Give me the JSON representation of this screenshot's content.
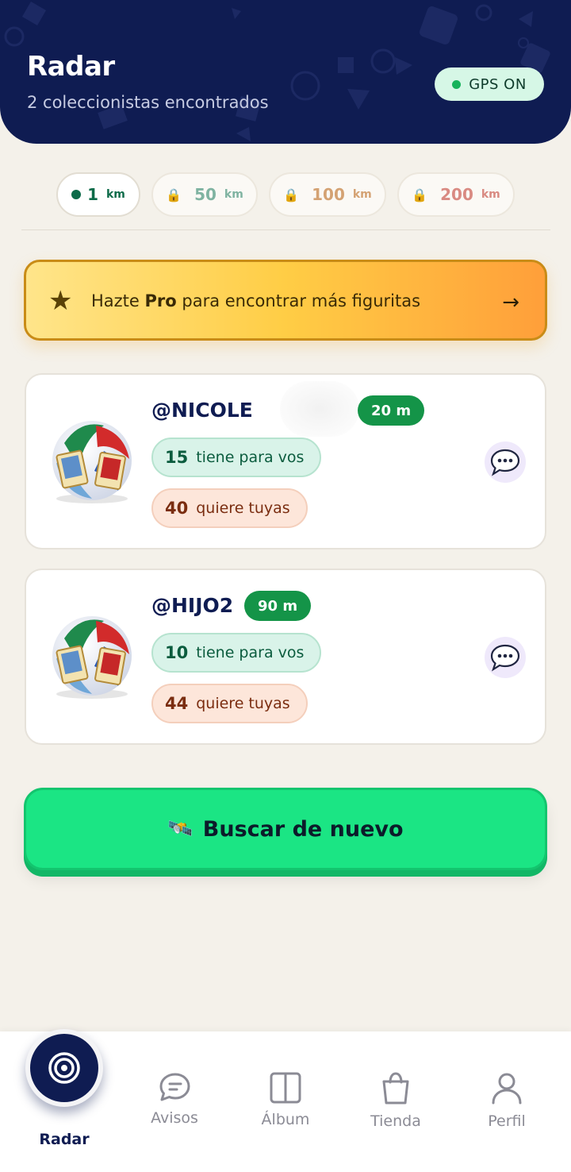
{
  "header": {
    "title": "Radar",
    "subtitle": "2 coleccionistas encontrados",
    "gps_label": "GPS ON"
  },
  "ranges": [
    {
      "value": "1",
      "unit": "km",
      "locked": false,
      "color": "#0d6b49"
    },
    {
      "value": "50",
      "unit": "km",
      "locked": true,
      "color": "#7fb3a1"
    },
    {
      "value": "100",
      "unit": "km",
      "locked": true,
      "color": "#d4a273"
    },
    {
      "value": "200",
      "unit": "km",
      "locked": true,
      "color": "#d98a82"
    }
  ],
  "pro_banner": {
    "before": "Hazte ",
    "bold": "Pro",
    "after": " para encontrar más figuritas",
    "arrow": "→"
  },
  "collectors": [
    {
      "username": "@NICOLE",
      "distance": "20 m",
      "has_count": "15",
      "has_label": "tiene para vos",
      "wants_count": "40",
      "wants_label": "quiere tuyas"
    },
    {
      "username": "@HIJO2",
      "distance": "90 m",
      "has_count": "10",
      "has_label": "tiene para vos",
      "wants_count": "44",
      "wants_label": "quiere tuyas"
    }
  ],
  "search_again": {
    "icon": "🛰️",
    "label": "Buscar de nuevo"
  },
  "nav": {
    "radar": "Radar",
    "avisos": "Avisos",
    "album": "Álbum",
    "tienda": "Tienda",
    "perfil": "Perfil"
  },
  "colors": {
    "navy": "#0f1c52",
    "green": "#149448",
    "cta_green": "#1be584"
  }
}
